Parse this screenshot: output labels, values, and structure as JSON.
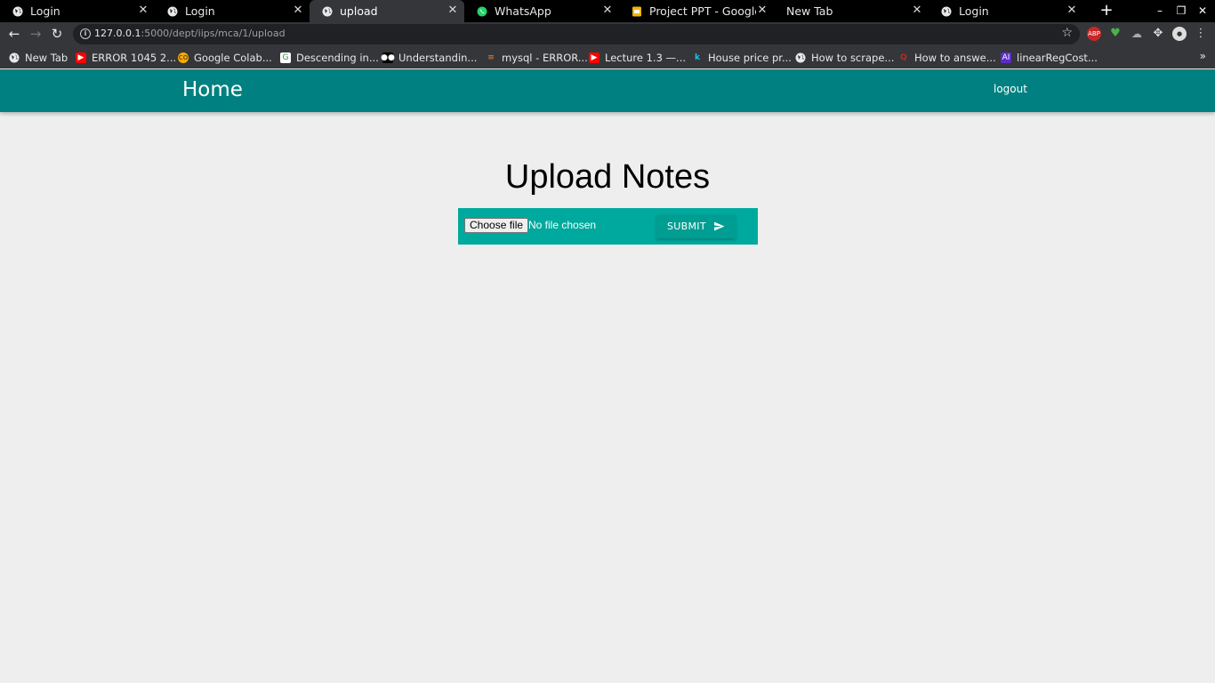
{
  "browser": {
    "tabs": [
      {
        "title": "Login",
        "icon": "globe-icon"
      },
      {
        "title": "Login",
        "icon": "globe-icon"
      },
      {
        "title": "upload",
        "icon": "globe-icon",
        "active": true
      },
      {
        "title": "WhatsApp",
        "icon": "whatsapp-icon"
      },
      {
        "title": "Project PPT - Google Slid",
        "icon": "slides-icon"
      },
      {
        "title": "New Tab",
        "icon": ""
      },
      {
        "title": "Login",
        "icon": "globe-icon"
      }
    ],
    "url_host": "127.0.0.1",
    "url_path": ":5000/dept/iips/mca/1/upload",
    "bookmarks": [
      {
        "label": "New Tab",
        "icon": "globe-icon"
      },
      {
        "label": "ERROR 1045 2...",
        "icon": "youtube-icon"
      },
      {
        "label": "Google Colab...",
        "icon": "colab-icon"
      },
      {
        "label": "Descending in...",
        "icon": "geeks-icon"
      },
      {
        "label": "Understandin...",
        "icon": "medium-icon"
      },
      {
        "label": "mysql - ERROR...",
        "icon": "stackoverflow-icon"
      },
      {
        "label": "Lecture 1.3 —...",
        "icon": "youtube-icon"
      },
      {
        "label": "House price pr...",
        "icon": "kaggle-icon"
      },
      {
        "label": "How to scrape...",
        "icon": "globe-icon"
      },
      {
        "label": "How to answe...",
        "icon": "quora-icon"
      },
      {
        "label": "linearRegCost...",
        "icon": "ai-icon"
      }
    ],
    "bookmarks_more": "»"
  },
  "page": {
    "brand": "Home",
    "logout": "logout",
    "heading": "Upload Notes",
    "file_button": "Choose file",
    "file_status": "No file chosen",
    "submit": "SUBMIT"
  },
  "colors": {
    "navbar": "#008080",
    "upload_box": "#00a99d",
    "background": "#eeeeee"
  }
}
